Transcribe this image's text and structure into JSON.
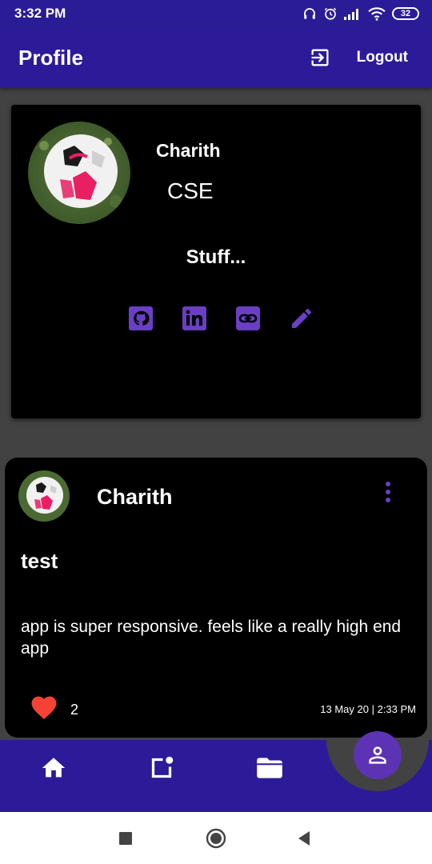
{
  "status_bar": {
    "time": "3:32 PM",
    "battery": "32",
    "icons": [
      "headphones-icon",
      "alarm-icon",
      "signal-icon",
      "wifi-icon",
      "battery-icon"
    ]
  },
  "app_bar": {
    "title": "Profile",
    "logout_label": "Logout",
    "logout_icon": "exit-to-app-icon"
  },
  "profile": {
    "name": "Charith",
    "department": "CSE",
    "bio": "Stuff...",
    "links": [
      "github-icon",
      "linkedin-icon",
      "link-icon",
      "edit-icon"
    ]
  },
  "post": {
    "author": "Charith",
    "title": "test",
    "body": "app is super responsive. feels like a really high end app",
    "likes": "2",
    "timestamp": "13 May 20 | 2:33 PM"
  },
  "bottom_nav": {
    "items": [
      "home-icon",
      "new-post-icon",
      "folder-icon",
      "profile-icon"
    ],
    "active": "profile-icon"
  },
  "colors": {
    "primary": "#2d1a99",
    "accent": "#5c33b4",
    "icon_purple": "#6a3fc4",
    "like": "#f44336",
    "background": "#424242",
    "card": "#000000"
  }
}
